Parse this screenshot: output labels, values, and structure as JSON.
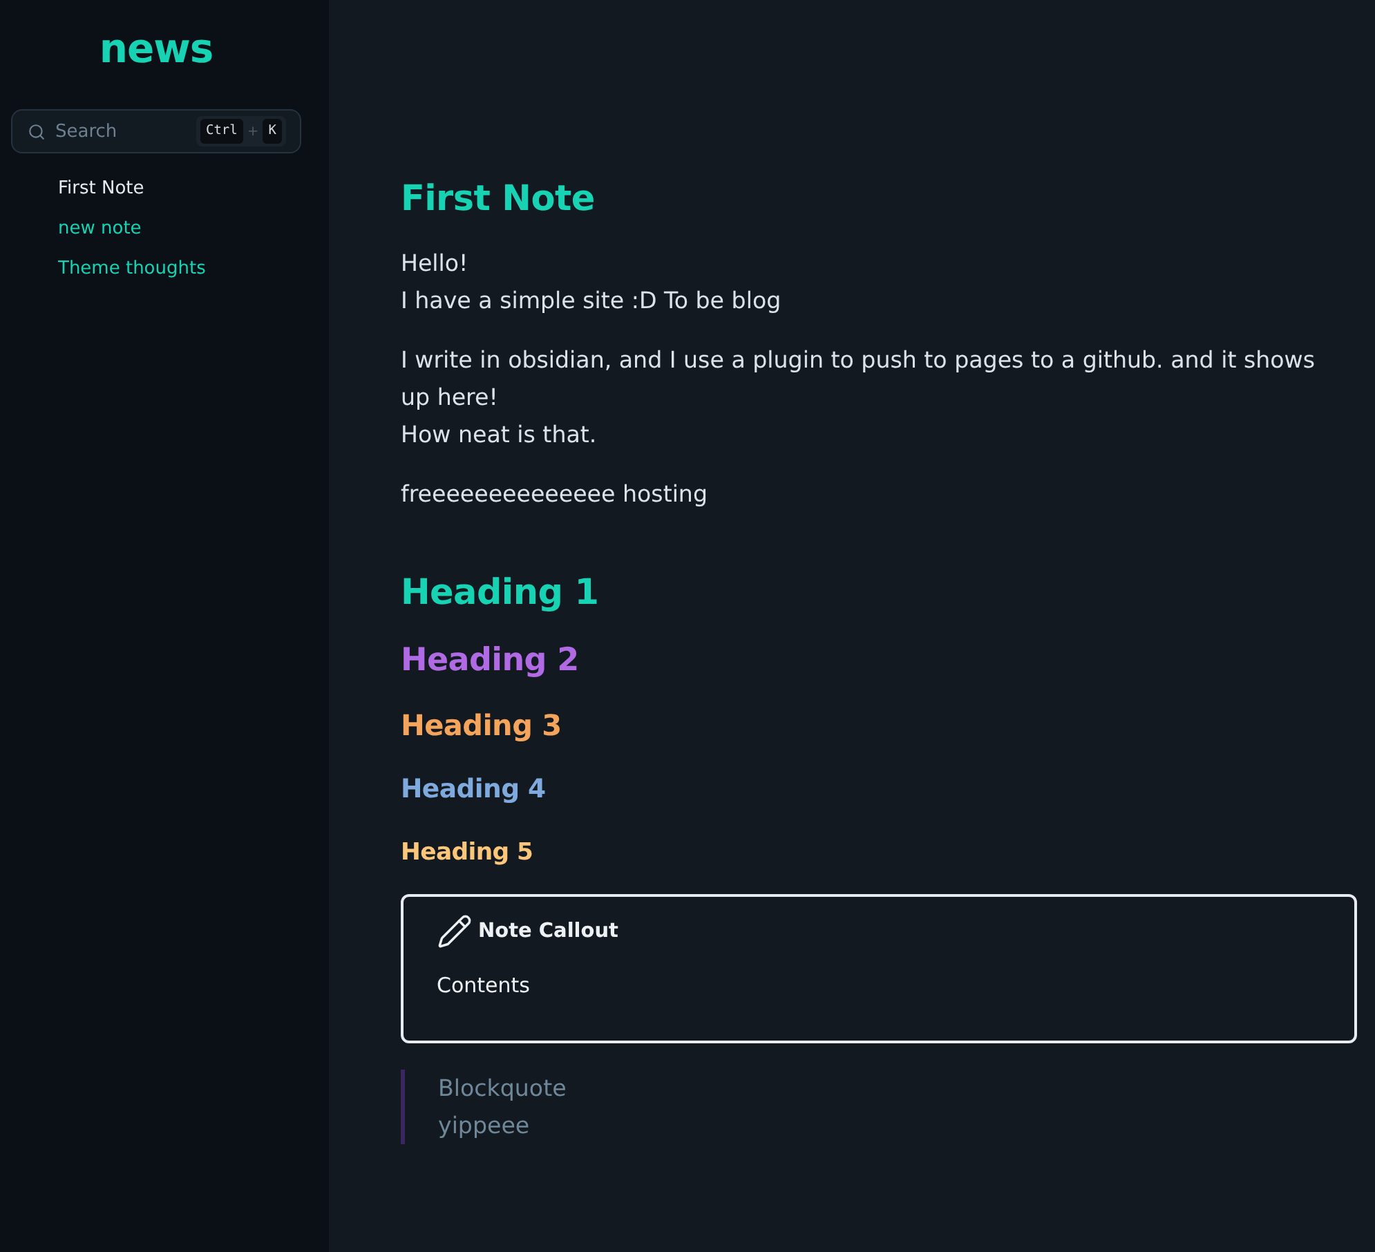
{
  "sidebar": {
    "site_title": "news",
    "search": {
      "placeholder": "Search",
      "shortcut": {
        "keys": [
          "Ctrl",
          "K"
        ],
        "separator": "+"
      }
    },
    "items": [
      {
        "label": "First Note",
        "selected": true
      },
      {
        "label": "new note",
        "selected": false
      },
      {
        "label": "Theme thoughts",
        "selected": false
      }
    ]
  },
  "article": {
    "title": "First Note",
    "blocks": [
      {
        "kind": "paragraph",
        "lines": [
          "Hello!",
          "I have a simple site :D To be blog"
        ]
      },
      {
        "kind": "paragraph",
        "lines": [
          "I write in obsidian, and I use a plugin to push to pages to a github. and it shows up here!",
          "How neat is that."
        ]
      },
      {
        "kind": "paragraph",
        "lines": [
          "freeeeeeeeeeeeee hosting"
        ]
      },
      {
        "kind": "h1",
        "text": "Heading 1"
      },
      {
        "kind": "h2",
        "text": "Heading 2"
      },
      {
        "kind": "h3",
        "text": "Heading 3"
      },
      {
        "kind": "h4",
        "text": "Heading 4"
      },
      {
        "kind": "h5",
        "text": "Heading 5"
      },
      {
        "kind": "callout",
        "title": "Note Callout",
        "content": "Contents"
      },
      {
        "kind": "blockquote",
        "lines": [
          "Blockquote",
          "yippeee"
        ]
      }
    ]
  }
}
